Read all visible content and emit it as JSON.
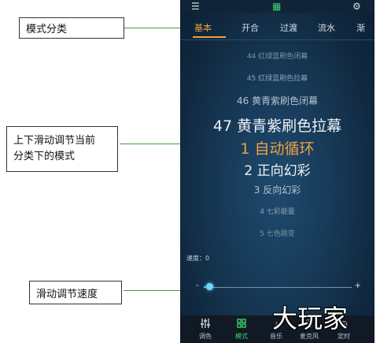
{
  "callouts": {
    "mode_category": "模式分类",
    "swipe_line1": "上下滑动调节当前",
    "swipe_line2": "分类下的模式",
    "speed": "滑动调节速度"
  },
  "tabs": [
    {
      "label": "基本",
      "active": true
    },
    {
      "label": "开合",
      "active": false
    },
    {
      "label": "过渡",
      "active": false
    },
    {
      "label": "流水",
      "active": false
    },
    {
      "label": "渐",
      "active": false
    }
  ],
  "modes": [
    {
      "label": "44 红绿蓝刷色闭幕",
      "color": "#7f93a6"
    },
    {
      "label": "45 红绿蓝刷色拉幕",
      "color": "#8ea0b2"
    },
    {
      "label": "46 黄青紫刷色闭幕",
      "color": "#b4c1cd"
    },
    {
      "label": "47 黄青紫刷色拉幕",
      "color": "#eef2f6"
    },
    {
      "label": "1 自动循环",
      "color": "#f0a040"
    },
    {
      "label": "2 正向幻彩",
      "color": "#eef2f6"
    },
    {
      "label": "3 反向幻彩",
      "color": "#b4c1cd"
    },
    {
      "label": "4 七彩能量",
      "color": "#8ea0b2"
    },
    {
      "label": "5 七色跳变",
      "color": "#7f93a6"
    }
  ],
  "speed": {
    "label": "速度：0",
    "minus": "-",
    "plus": "+",
    "value_fraction": 0.0
  },
  "bottom_nav": [
    {
      "label": "调色",
      "icon": "sliders-icon",
      "active": false
    },
    {
      "label": "模式",
      "icon": "grid-icon",
      "active": true
    },
    {
      "label": "音乐",
      "icon": "music-icon",
      "active": false
    },
    {
      "label": "麦克风",
      "icon": "mic-icon",
      "active": false
    },
    {
      "label": "定时",
      "icon": "clock-icon",
      "active": false
    }
  ],
  "watermark": "大玩家",
  "colors": {
    "accent_orange": "#f0a040",
    "accent_green": "#3ecf6a",
    "slider_blue": "#4fc7ff",
    "arrow_green": "#3aa33a"
  }
}
